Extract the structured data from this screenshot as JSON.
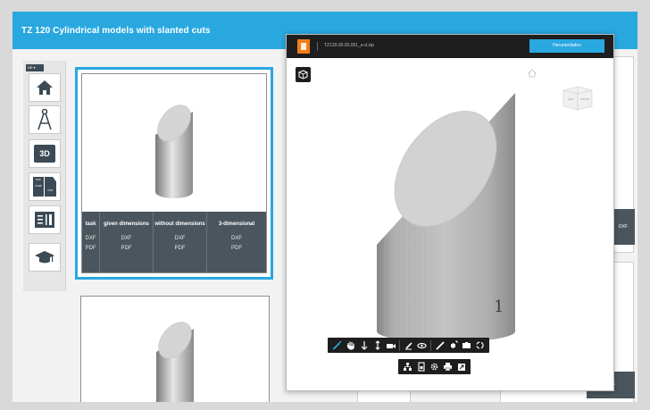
{
  "header": {
    "title": "TZ 120 Cylindrical models with slanted cuts"
  },
  "sidebar": {
    "lang": "DE ▾",
    "items": [
      {
        "name": "home",
        "icon": "home-icon"
      },
      {
        "name": "drawing-tools",
        "icon": "compass-icon"
      },
      {
        "name": "3d-view",
        "icon": "3d-icon",
        "label": "3D"
      },
      {
        "name": "file-formats",
        "icon": "formats-icon",
        "formats": [
          "DXF",
          "STEP",
          "PDF"
        ]
      },
      {
        "name": "worksheet",
        "icon": "worksheet-icon"
      },
      {
        "name": "education",
        "icon": "graduation-cap-icon"
      }
    ]
  },
  "card": {
    "columns": [
      {
        "header": "task",
        "links": [
          "DXF",
          "PDF"
        ]
      },
      {
        "header": "given dimensions",
        "links": [
          "DXF",
          "PDF"
        ]
      },
      {
        "header": "without dimensions",
        "links": [
          "DXF",
          "PDF"
        ]
      },
      {
        "header": "3-dimensional",
        "links": [
          "DXF",
          "PDF"
        ]
      }
    ]
  },
  "background_tags": {
    "dxf1": "DXF",
    "dxf2": "DXF"
  },
  "viewer": {
    "filename": "TZ120.00.00.001_e-d.zip",
    "download_label": "Herunterladen",
    "model_number": "1",
    "cube_labels": [
      "LEFT",
      "FRONT"
    ],
    "toolbar_row1": [
      "measure",
      "pan",
      "rotate-y",
      "rotate-z",
      "camera",
      "markup",
      "hide",
      "pen",
      "explode",
      "section",
      "reset"
    ],
    "toolbar_row2": [
      "structure",
      "export",
      "settings",
      "print",
      "fullscreen"
    ]
  },
  "colors": {
    "accent": "#29a8e0",
    "dark": "#1e1e1e",
    "table": "#4a555d",
    "logo": "#f07d1a"
  }
}
